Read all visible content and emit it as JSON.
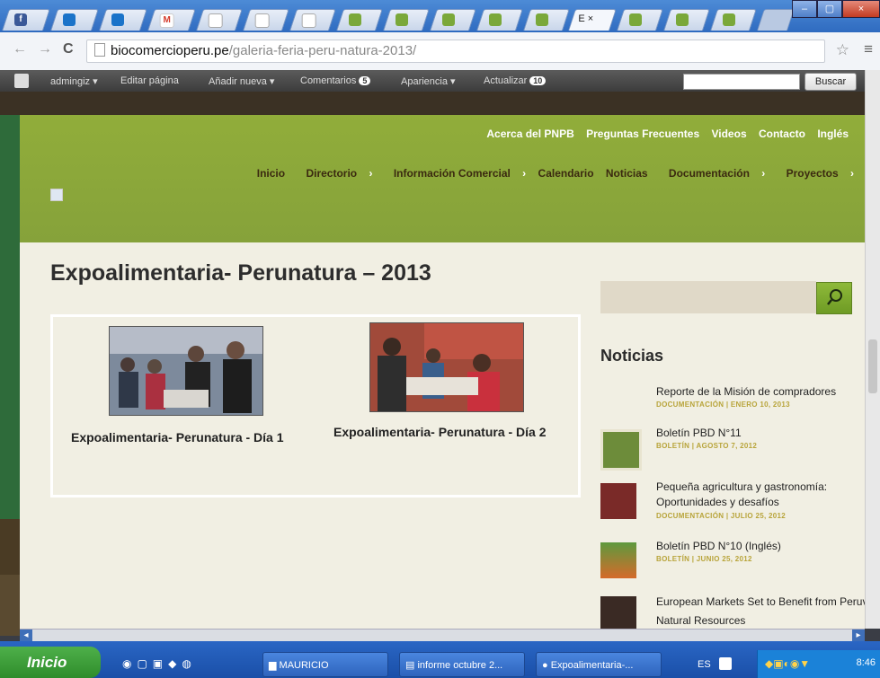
{
  "browser": {
    "active_tab_label": "E",
    "active_tab_close": "×",
    "url_domain": "biocomercioperu.pe",
    "url_path": "/galeria-feria-peru-natura-2013/",
    "window_controls": [
      "–",
      "▢",
      "×"
    ]
  },
  "admin_bar": {
    "items": [
      "admingiz",
      "Editar página",
      "Añadir nueva",
      "Comentarios",
      "Apariencia",
      "Actualizar"
    ],
    "comments_badge": "5",
    "updates_badge": "10",
    "search_button": "Buscar"
  },
  "site": {
    "top_menu": [
      "Acerca del PNPB",
      "Preguntas Frecuentes",
      "Videos",
      "Contacto",
      "Inglés"
    ],
    "main_menu": [
      "Inicio",
      "Directorio",
      "Información Comercial",
      "Calendario",
      "Noticias",
      "Documentación",
      "Proyectos"
    ],
    "page_title": "Expoalimentaria- Perunatura – 2013",
    "gallery": [
      {
        "caption": "Expoalimentaria- Perunatura - Día 1"
      },
      {
        "caption": "Expoalimentaria- Perunatura - Día 2"
      }
    ],
    "sidebar": {
      "heading": "Noticias",
      "items": [
        {
          "title": "Reporte de la Misión de compradores",
          "meta": "DOCUMENTACIÓN | ENERO 10, 2013"
        },
        {
          "title": "Boletín PBD N°11",
          "meta": "BOLETÍN | AGOSTO 7, 2012"
        },
        {
          "title": "Pequeña agricultura y gastronomía: Oportunidades y desafíos",
          "meta": "DOCUMENTACIÓN | JULIO 25, 2012"
        },
        {
          "title": "Boletín PBD N°10 (Inglés)",
          "meta": "BOLETÍN | JUNIO 25, 2012"
        },
        {
          "title": "European Markets Set to Benefit from Peruvian Natural Resources",
          "meta": ""
        }
      ]
    }
  },
  "taskbar": {
    "start_label": "Inicio",
    "items": [
      "MAURICIO",
      "informe octubre 2...",
      "Expoalimentaria-..."
    ],
    "language": "ES",
    "time": "8:46"
  },
  "colors": {
    "header_green": "#8ca93a",
    "title_text": "#2d2d2d",
    "meta_gold": "#b8a43a",
    "taskbar_blue": "#2a66c4"
  }
}
